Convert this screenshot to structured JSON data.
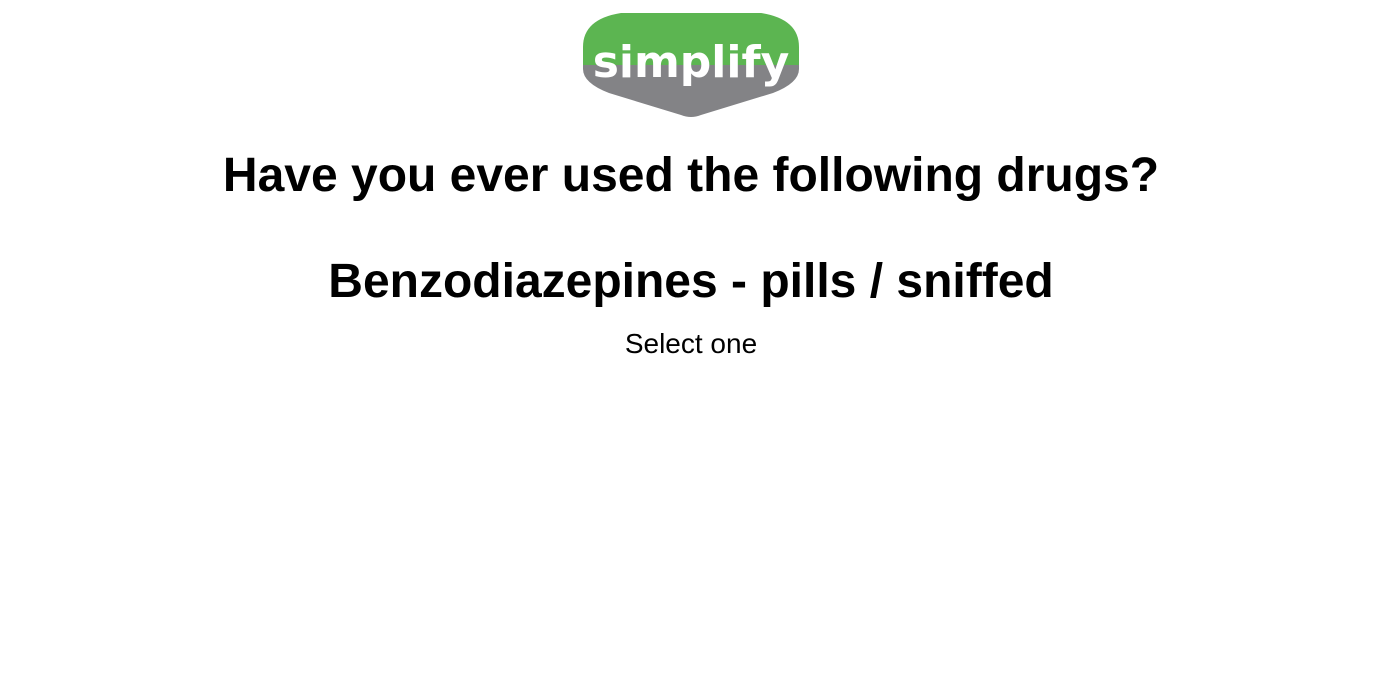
{
  "brand": {
    "logo_text": "simplify",
    "colors": {
      "green": "#5cb551",
      "gray": "#838386",
      "text": "#ffffff"
    }
  },
  "survey": {
    "question": "Have you ever used the following drugs?",
    "item": "Benzodiazepines - pills / sniffed",
    "instruction": "Select one"
  }
}
